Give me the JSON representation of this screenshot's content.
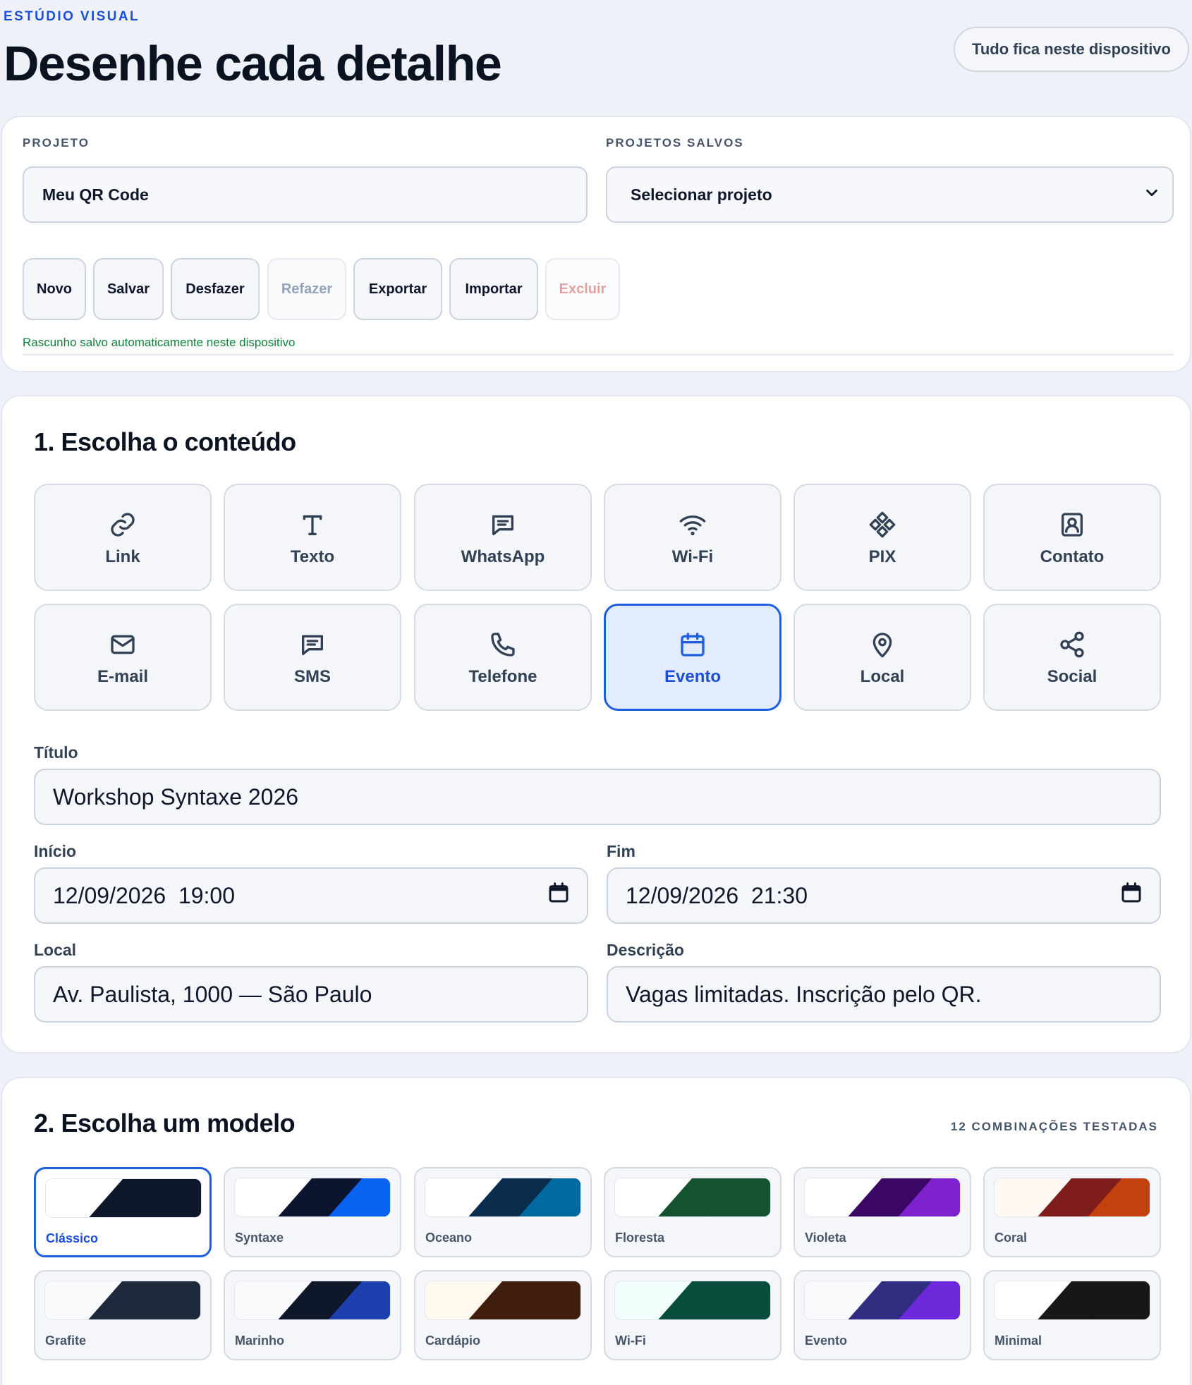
{
  "header": {
    "eyebrow": "ESTÚDIO VISUAL",
    "title": "Desenhe cada detalhe",
    "device_badge": "Tudo fica neste dispositivo"
  },
  "project": {
    "project_label": "PROJETO",
    "project_name": "Meu QR Code",
    "saved_label": "PROJETOS SALVOS",
    "saved_select": "Selecionar projeto",
    "buttons": {
      "new": "Novo",
      "save": "Salvar",
      "undo": "Desfazer",
      "redo": "Refazer",
      "export": "Exportar",
      "import": "Importar",
      "delete": "Excluir"
    },
    "autosave_status": "Rascunho salvo automaticamente neste dispositivo"
  },
  "content": {
    "title": "1. Escolha o conteúdo",
    "types": [
      {
        "label": "Link",
        "icon": "link-icon"
      },
      {
        "label": "Texto",
        "icon": "text-icon"
      },
      {
        "label": "WhatsApp",
        "icon": "chat-icon"
      },
      {
        "label": "Wi-Fi",
        "icon": "wifi-icon"
      },
      {
        "label": "PIX",
        "icon": "pix-icon"
      },
      {
        "label": "Contato",
        "icon": "contact-icon"
      },
      {
        "label": "E-mail",
        "icon": "mail-icon"
      },
      {
        "label": "SMS",
        "icon": "sms-icon"
      },
      {
        "label": "Telefone",
        "icon": "phone-icon"
      },
      {
        "label": "Evento",
        "icon": "calendar-icon",
        "selected": true
      },
      {
        "label": "Local",
        "icon": "map-pin-icon"
      },
      {
        "label": "Social",
        "icon": "share-icon"
      }
    ],
    "fields": {
      "title_label": "Título",
      "title_value": "Workshop Syntaxe 2026",
      "start_label": "Início",
      "start_value": "12/09/2026  19:00",
      "end_label": "Fim",
      "end_value": "12/09/2026  21:30",
      "location_label": "Local",
      "location_value": "Av. Paulista, 1000 — São Paulo",
      "description_label": "Descrição",
      "description_value": "Vagas limitadas. Inscrição pelo QR."
    }
  },
  "models": {
    "title": "2. Escolha um modelo",
    "note": "12 COMBINAÇÕES TESTADAS",
    "items": [
      {
        "name": "Clássico",
        "colors": [
          "#ffffff",
          "#0f172a",
          "#0f172a"
        ],
        "selected": true
      },
      {
        "name": "Syntaxe",
        "colors": [
          "#ffffff",
          "#0b1530",
          "#0a62f0"
        ]
      },
      {
        "name": "Oceano",
        "colors": [
          "#ffffff",
          "#0a2d4d",
          "#0369a1"
        ]
      },
      {
        "name": "Floresta",
        "colors": [
          "#ffffff",
          "#14532d",
          "#14532d"
        ]
      },
      {
        "name": "Violeta",
        "colors": [
          "#ffffff",
          "#3b0764",
          "#7e22ce"
        ]
      },
      {
        "name": "Coral",
        "colors": [
          "#fff7f2",
          "#7f1d1d",
          "#c2410c"
        ]
      },
      {
        "name": "Grafite",
        "colors": [
          "#f8fafc",
          "#1e293b",
          "#1e293b"
        ]
      },
      {
        "name": "Marinho",
        "colors": [
          "#f8fafc",
          "#0f172a",
          "#1e40af"
        ]
      },
      {
        "name": "Cardápio",
        "colors": [
          "#fff8ee",
          "#3f1f0c",
          "#3f1f0c"
        ]
      },
      {
        "name": "Wi-Fi",
        "colors": [
          "#f0fdfa",
          "#064e3b",
          "#064e3b"
        ]
      },
      {
        "name": "Evento",
        "colors": [
          "#f8fafc",
          "#312e81",
          "#6d28d9"
        ]
      },
      {
        "name": "Minimal",
        "colors": [
          "#ffffff",
          "#171717",
          "#171717"
        ]
      }
    ]
  }
}
